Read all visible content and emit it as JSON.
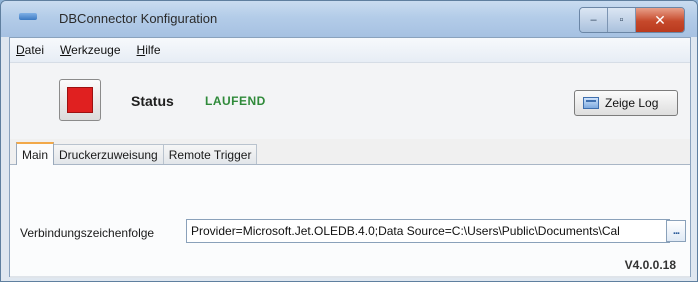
{
  "window": {
    "title": "DBConnector Konfiguration",
    "controls": {
      "minimize": "–",
      "maximize": "▫",
      "close": "✕"
    }
  },
  "menu": [
    {
      "label": "Datei",
      "accel": "D"
    },
    {
      "label": "Werkzeuge",
      "accel": "W"
    },
    {
      "label": "Hilfe",
      "accel": "H"
    }
  ],
  "status": {
    "label": "Status",
    "value": "LAUFEND",
    "indicator_color": "#e02020",
    "value_color": "#2f8a3a"
  },
  "toolbar": {
    "log_button": "Zeige Log",
    "log_icon": "log-window-icon"
  },
  "tabs": [
    {
      "label": "Main",
      "active": true
    },
    {
      "label": "Druckerzuweisung",
      "active": false
    },
    {
      "label": "Remote Trigger",
      "active": false
    }
  ],
  "connection": {
    "label": "Verbindungszeichenfolge",
    "value": "Provider=Microsoft.Jet.OLEDB.4.0;Data Source=C:\\Users\\Public\\Documents\\Cal",
    "browse_label": "..."
  },
  "version": "V4.0.0.18"
}
